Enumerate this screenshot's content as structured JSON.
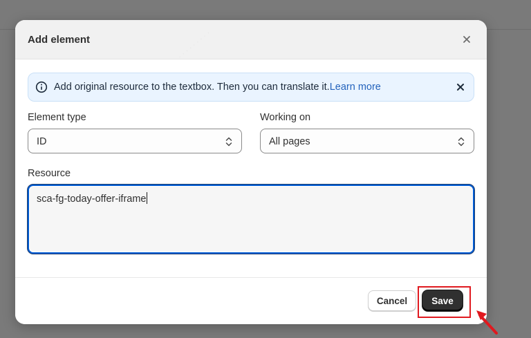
{
  "modal": {
    "title": "Add element",
    "close_icon": "close-icon"
  },
  "banner": {
    "icon": "info-icon",
    "text": "Add original resource to the textbox. Then you can translate it.",
    "link": "Learn more",
    "close_icon": "close-icon"
  },
  "form": {
    "element_type": {
      "label": "Element type",
      "value": "ID",
      "icon": "chevron-up-down-icon"
    },
    "working_on": {
      "label": "Working on",
      "value": "All pages",
      "icon": "chevron-up-down-icon"
    },
    "resource": {
      "label": "Resource",
      "value": "sca-fg-today-offer-iframe"
    }
  },
  "footer": {
    "cancel_label": "Cancel",
    "save_label": "Save"
  },
  "annotation": {
    "highlight_color": "#e0191f",
    "arrow_icon": "pointer-arrow-icon"
  },
  "colors": {
    "overlay": "#7a7a7a",
    "accent": "#005bd3",
    "banner_bg": "#eaf4ff",
    "link": "#2463bc",
    "primary_button": "#303030"
  }
}
